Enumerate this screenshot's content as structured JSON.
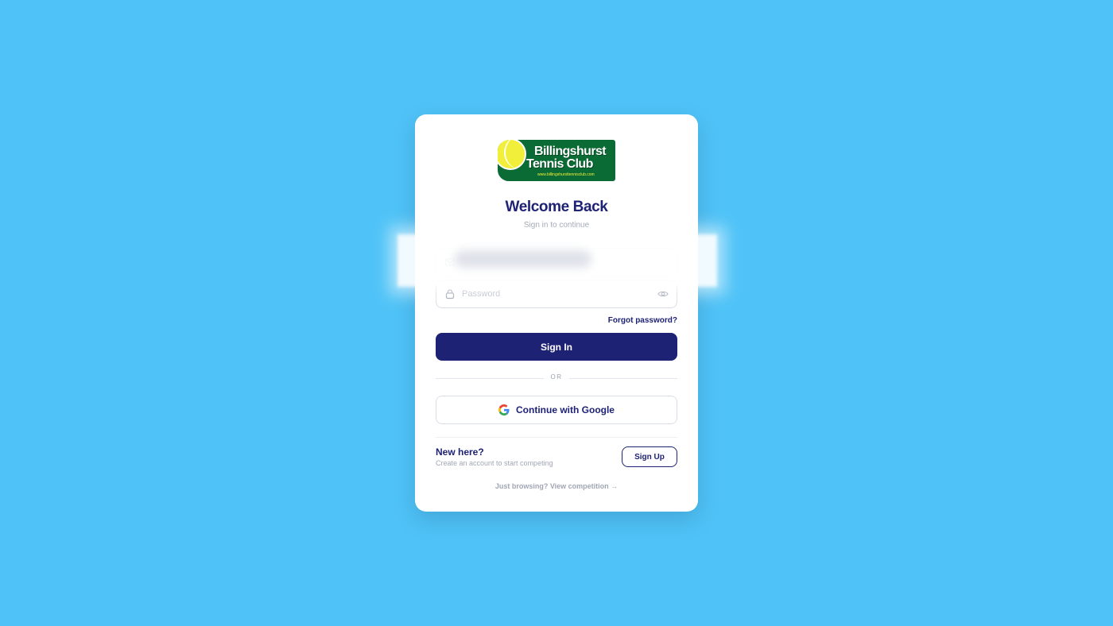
{
  "logo": {
    "line1": "Billingshurst",
    "line2": "Tennis Club",
    "url": "www.billingshursttennisclub.com"
  },
  "header": {
    "title": "Welcome Back",
    "subtitle": "Sign in to continue"
  },
  "form": {
    "email_value": "",
    "password_placeholder": "Password",
    "forgot_label": "Forgot password?",
    "signin_label": "Sign In"
  },
  "divider": {
    "label": "OR"
  },
  "google": {
    "label": "Continue with Google"
  },
  "signup": {
    "heading": "New here?",
    "subtext": "Create an account to start competing",
    "button_label": "Sign Up"
  },
  "browse": {
    "label": "Just browsing? View competition →"
  },
  "colors": {
    "background": "#4fc3f7",
    "primary": "#1e2275",
    "logo_green": "#0b6b35",
    "logo_ball": "#f2ef3a"
  }
}
